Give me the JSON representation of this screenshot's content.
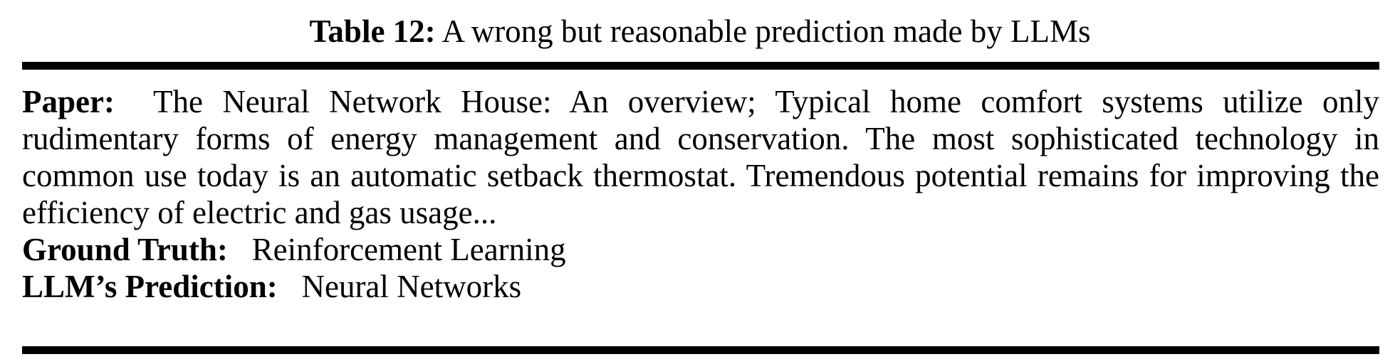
{
  "caption": {
    "label": "Table 12:",
    "text": "A wrong but reasonable prediction made by LLMs"
  },
  "rows": {
    "paper": {
      "label": "Paper:",
      "text": "The Neural Network House: An overview; Typical home comfort systems utilize only rudimentary forms of energy management and conservation. The most sophisticated technology in common use today is an automatic setback thermostat. Tremendous potential remains for improving the efficiency of electric and gas usage..."
    },
    "ground_truth": {
      "label": "Ground Truth:",
      "text": "Reinforcement Learning"
    },
    "prediction": {
      "label": "LLM’s Prediction:",
      "text": "Neural Networks"
    }
  }
}
